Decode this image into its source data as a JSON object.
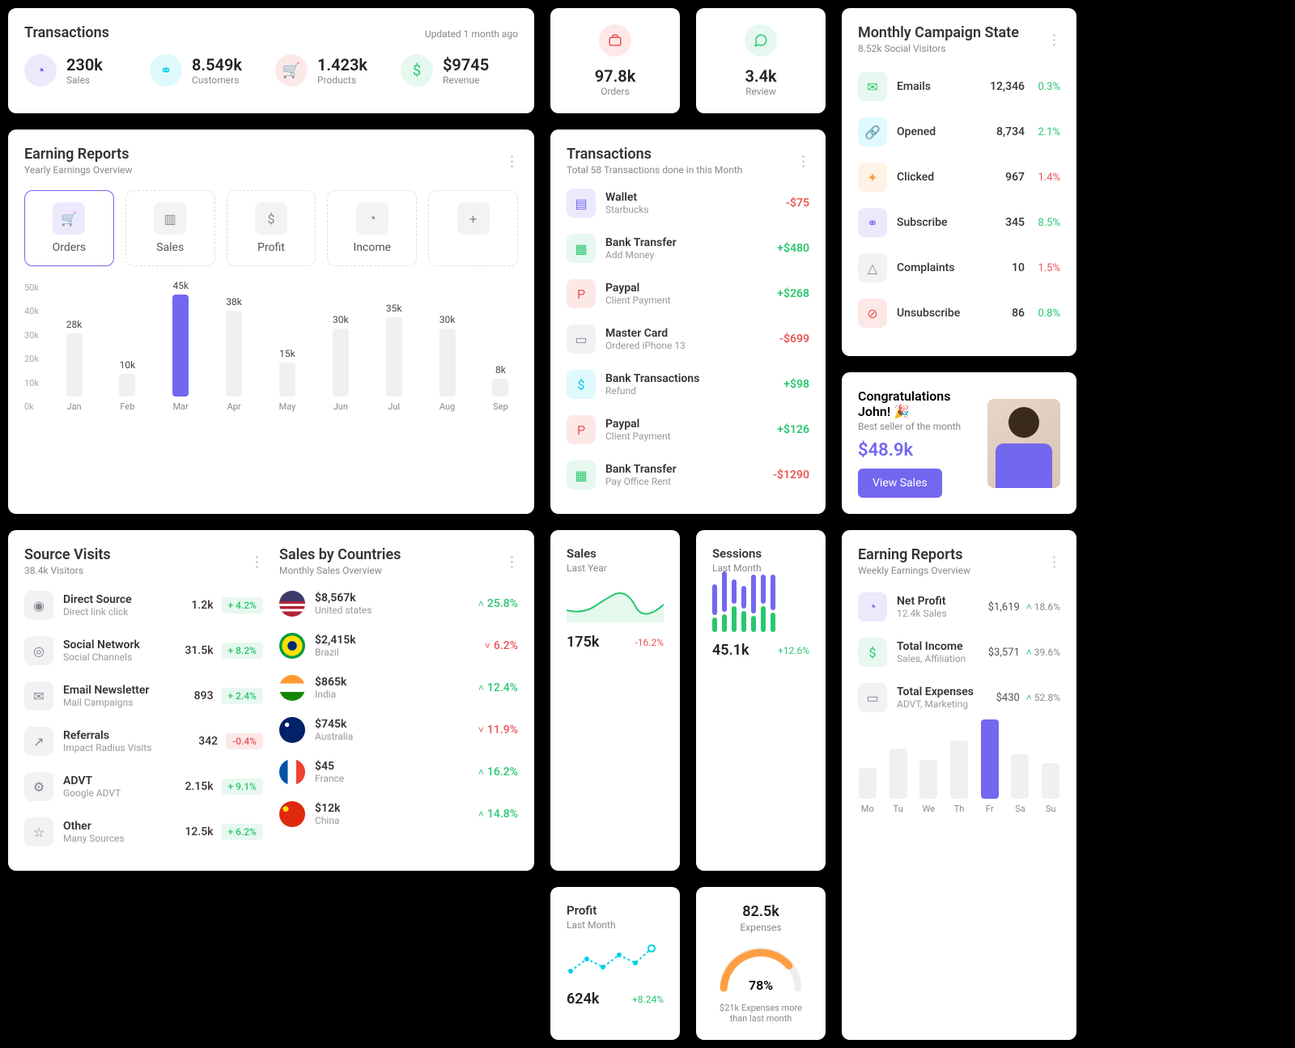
{
  "colors": {
    "purple": "#7367f0",
    "green": "#28c76f",
    "red": "#ea5455",
    "orange": "#ff9f43",
    "cyan": "#00cfe8",
    "gray": "#82868b"
  },
  "transactions_card": {
    "title": "Transactions",
    "updated": "Updated 1 month ago",
    "stats": [
      {
        "icon": "pie-icon",
        "bg": "#ece9fd",
        "color": "#7367f0",
        "value": "230k",
        "label": "Sales"
      },
      {
        "icon": "users-icon",
        "bg": "#e0f9fc",
        "color": "#00cfe8",
        "value": "8.549k",
        "label": "Customers"
      },
      {
        "icon": "cart-icon",
        "bg": "#fde8e8",
        "color": "#ea5455",
        "value": "1.423k",
        "label": "Products"
      },
      {
        "icon": "dollar-icon",
        "bg": "#e6f8ef",
        "color": "#28c76f",
        "value": "$9745",
        "label": "Revenue"
      }
    ]
  },
  "orders_mini": {
    "icon": "briefcase-icon",
    "bg": "#fde8e8",
    "color": "#ea5455",
    "value": "97.8k",
    "label": "Orders"
  },
  "review_mini": {
    "icon": "chat-icon",
    "bg": "#e6f8ef",
    "color": "#28c76f",
    "value": "3.4k",
    "label": "Review"
  },
  "campaign": {
    "title": "Monthly Campaign State",
    "sub": "8.52k Social Visitors",
    "rows": [
      {
        "icon": "mail-icon",
        "bg": "#e6f8ef",
        "color": "#28c76f",
        "label": "Emails",
        "value": "12,346",
        "pct": "0.3%",
        "pcol": "green"
      },
      {
        "icon": "link-icon",
        "bg": "#e0f9fc",
        "color": "#00cfe8",
        "label": "Opened",
        "value": "8,734",
        "pct": "2.1%",
        "pcol": "green"
      },
      {
        "icon": "mouse-icon",
        "bg": "#fff3e6",
        "color": "#ff9f43",
        "label": "Clicked",
        "value": "967",
        "pct": "1.4%",
        "pcol": "red"
      },
      {
        "icon": "users-icon",
        "bg": "#ece9fd",
        "color": "#7367f0",
        "label": "Subscribe",
        "value": "345",
        "pct": "8.5%",
        "pcol": "green"
      },
      {
        "icon": "alert-icon",
        "bg": "#f2f2f4",
        "color": "#82868b",
        "label": "Complaints",
        "value": "10",
        "pct": "1.5%",
        "pcol": "red"
      },
      {
        "icon": "ban-icon",
        "bg": "#fde8e8",
        "color": "#ea5455",
        "label": "Unsubscribe",
        "value": "86",
        "pct": "0.8%",
        "pcol": "green"
      }
    ]
  },
  "earning_yearly": {
    "title": "Earning Reports",
    "sub": "Yearly Earnings Overview",
    "tabs": [
      {
        "label": "Orders",
        "icon": "cart-icon",
        "active": true
      },
      {
        "label": "Sales",
        "icon": "bar-icon",
        "active": false
      },
      {
        "label": "Profit",
        "icon": "dollar-icon",
        "active": false
      },
      {
        "label": "Income",
        "icon": "pie-icon",
        "active": false
      },
      {
        "label": "",
        "icon": "plus-icon",
        "active": false
      }
    ]
  },
  "chart_data": {
    "type": "bar",
    "title": "Earning Reports — Orders",
    "xlabel": "",
    "ylabel": "",
    "ylim": [
      0,
      50
    ],
    "ytick_labels": [
      "0k",
      "10k",
      "20k",
      "30k",
      "40k",
      "50k"
    ],
    "categories": [
      "Jan",
      "Feb",
      "Mar",
      "Apr",
      "May",
      "Jun",
      "Jul",
      "Aug",
      "Sep"
    ],
    "values": [
      28,
      10,
      45,
      38,
      15,
      30,
      35,
      30,
      8
    ],
    "value_labels": [
      "28k",
      "10k",
      "45k",
      "38k",
      "15k",
      "30k",
      "35k",
      "30k",
      "8k"
    ],
    "highlight_index": 2
  },
  "transactions_month": {
    "title": "Transactions",
    "sub": "Total 58 Transactions done in this Month",
    "rows": [
      {
        "icon": "wallet-icon",
        "bg": "#ece9fd",
        "color": "#7367f0",
        "t1": "Wallet",
        "t2": "Starbucks",
        "amt": "-$75",
        "col": "red"
      },
      {
        "icon": "bank-icon",
        "bg": "#e6f8ef",
        "color": "#28c76f",
        "t1": "Bank Transfer",
        "t2": "Add Money",
        "amt": "+$480",
        "col": "green"
      },
      {
        "icon": "paypal-icon",
        "bg": "#fde8e8",
        "color": "#ea5455",
        "t1": "Paypal",
        "t2": "Client Payment",
        "amt": "+$268",
        "col": "green"
      },
      {
        "icon": "card-icon",
        "bg": "#f2f2f4",
        "color": "#82868b",
        "t1": "Master Card",
        "t2": "Ordered iPhone 13",
        "amt": "-$699",
        "col": "red"
      },
      {
        "icon": "bank2-icon",
        "bg": "#e0f9fc",
        "color": "#00cfe8",
        "t1": "Bank Transactions",
        "t2": "Refund",
        "amt": "+$98",
        "col": "green"
      },
      {
        "icon": "paypal-icon",
        "bg": "#fde8e8",
        "color": "#ea5455",
        "t1": "Paypal",
        "t2": "Client Payment",
        "amt": "+$126",
        "col": "green"
      },
      {
        "icon": "bank-icon",
        "bg": "#e6f8ef",
        "color": "#28c76f",
        "t1": "Bank Transfer",
        "t2": "Pay Office Rent",
        "amt": "-$1290",
        "col": "red"
      }
    ]
  },
  "congrats": {
    "title": "Congratulations John! 🎉",
    "sub": "Best seller of the month",
    "amount": "$48.9k",
    "button": "View Sales"
  },
  "source_visits": {
    "title": "Source Visits",
    "sub": "38.4k Visitors",
    "rows": [
      {
        "icon": "globe-icon",
        "t1": "Direct Source",
        "t2": "Direct link click",
        "value": "1.2k",
        "pct": "+ 4.2%",
        "pcol": "g"
      },
      {
        "icon": "globe2-icon",
        "t1": "Social Network",
        "t2": "Social Channels",
        "value": "31.5k",
        "pct": "+ 8.2%",
        "pcol": "g"
      },
      {
        "icon": "mail-icon",
        "t1": "Email Newsletter",
        "t2": "Mail Campaigns",
        "value": "893",
        "pct": "+ 2.4%",
        "pcol": "g"
      },
      {
        "icon": "ext-icon",
        "t1": "Referrals",
        "t2": "Impact Radius Visits",
        "value": "342",
        "pct": "-0.4%",
        "pcol": "r"
      },
      {
        "icon": "cog-icon",
        "t1": "ADVT",
        "t2": "Google ADVT",
        "value": "2.15k",
        "pct": "+ 9.1%",
        "pcol": "g"
      },
      {
        "icon": "star-icon",
        "t1": "Other",
        "t2": "Many Sources",
        "value": "12.5k",
        "pct": "+ 6.2%",
        "pcol": "g"
      }
    ]
  },
  "countries": {
    "title": "Sales by Countries",
    "sub": "Monthly Sales Overview",
    "rows": [
      {
        "flag": "us",
        "t1": "$8,567k",
        "t2": "United states",
        "pct": "25.8%",
        "dir": "up",
        "col": "green"
      },
      {
        "flag": "br",
        "t1": "$2,415k",
        "t2": "Brazil",
        "pct": "6.2%",
        "dir": "down",
        "col": "red"
      },
      {
        "flag": "in",
        "t1": "$865k",
        "t2": "India",
        "pct": "12.4%",
        "dir": "up",
        "col": "green"
      },
      {
        "flag": "au",
        "t1": "$745k",
        "t2": "Australia",
        "pct": "11.9%",
        "dir": "down",
        "col": "red"
      },
      {
        "flag": "fr",
        "t1": "$45",
        "t2": "France",
        "pct": "16.2%",
        "dir": "up",
        "col": "green"
      },
      {
        "flag": "cn",
        "t1": "$12k",
        "t2": "China",
        "pct": "14.8%",
        "dir": "up",
        "col": "green"
      }
    ]
  },
  "sales_spark": {
    "title": "Sales",
    "sub": "Last Year",
    "value": "175k",
    "pct": "-16.2%",
    "pcol": "red"
  },
  "sessions_spark": {
    "title": "Sessions",
    "sub": "Last Month",
    "value": "45.1k",
    "pct": "+12.6%",
    "pcol": "green",
    "bars": [
      [
        38,
        18
      ],
      [
        50,
        22
      ],
      [
        30,
        32
      ],
      [
        28,
        26
      ],
      [
        48,
        20
      ],
      [
        36,
        32
      ],
      [
        44,
        24
      ]
    ]
  },
  "profit_spark": {
    "title": "Profit",
    "sub": "Last Month",
    "value": "624k",
    "pct": "+8.24%",
    "pcol": "green"
  },
  "expenses_gauge": {
    "value": "82.5k",
    "label": "Expenses",
    "pct": "78%",
    "note": "$21k Expenses more than last month"
  },
  "earning_weekly": {
    "title": "Earning Reports",
    "sub": "Weekly Earnings Overview",
    "rows": [
      {
        "icon": "pie-icon",
        "bg": "#ece9fd",
        "color": "#7367f0",
        "t1": "Net Profit",
        "t2": "12.4k Sales",
        "amt": "$1,619",
        "pct": "18.6%"
      },
      {
        "icon": "dollar-icon",
        "bg": "#e6f8ef",
        "color": "#28c76f",
        "t1": "Total Income",
        "t2": "Sales, Affiliation",
        "amt": "$3,571",
        "pct": "39.6%"
      },
      {
        "icon": "card-icon",
        "bg": "#f2f2f4",
        "color": "#82868b",
        "t1": "Total Expenses",
        "t2": "ADVT, Marketing",
        "amt": "$430",
        "pct": "52.8%"
      }
    ],
    "chart": {
      "type": "bar",
      "categories": [
        "Mo",
        "Tu",
        "We",
        "Th",
        "Fr",
        "Sa",
        "Su"
      ],
      "values": [
        38,
        62,
        48,
        72,
        98,
        55,
        44
      ],
      "highlight_index": 4
    }
  }
}
